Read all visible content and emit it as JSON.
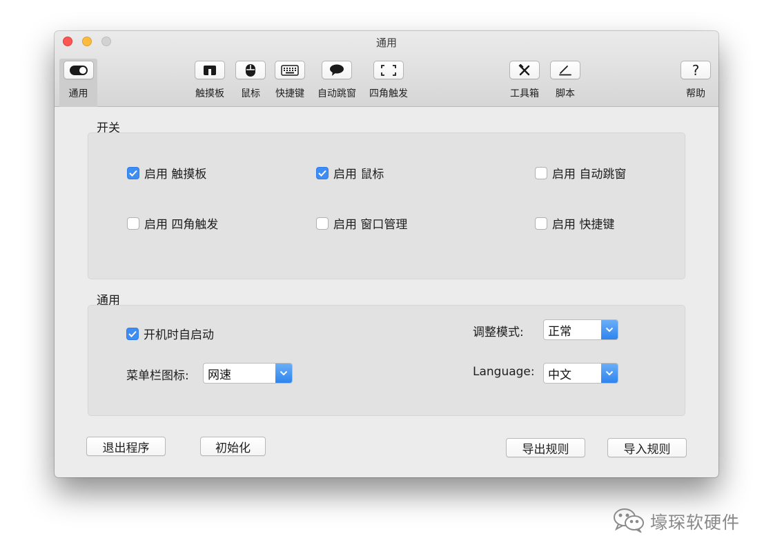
{
  "window": {
    "title": "通用"
  },
  "toolbar": {
    "items": [
      {
        "label": "通用",
        "icon": "toggle-icon"
      },
      {
        "label": "触摸板",
        "icon": "trackpad-icon"
      },
      {
        "label": "鼠标",
        "icon": "mouse-icon"
      },
      {
        "label": "快捷键",
        "icon": "keyboard-icon"
      },
      {
        "label": "自动跳窗",
        "icon": "speech-bubble-icon"
      },
      {
        "label": "四角触发",
        "icon": "corners-icon"
      },
      {
        "label": "工具箱",
        "icon": "tools-icon"
      },
      {
        "label": "脚本",
        "icon": "pen-icon"
      },
      {
        "label": "帮助",
        "icon": "help-icon",
        "glyph": "?"
      }
    ]
  },
  "switches": {
    "title": "开关",
    "items": [
      {
        "label": "启用 触摸板",
        "checked": true
      },
      {
        "label": "启用 鼠标",
        "checked": true
      },
      {
        "label": "启用 自动跳窗",
        "checked": false
      },
      {
        "label": "启用 四角触发",
        "checked": false
      },
      {
        "label": "启用 窗口管理",
        "checked": false
      },
      {
        "label": "启用 快捷键",
        "checked": false
      }
    ]
  },
  "general": {
    "title": "通用",
    "autostart": {
      "label": "开机时自启动",
      "checked": true
    },
    "menubar_icon": {
      "label": "菜单栏图标:",
      "value": "网速"
    },
    "adjust_mode": {
      "label": "调整模式:",
      "value": "正常"
    },
    "language": {
      "label": "Language:",
      "value": "中文"
    }
  },
  "buttons": {
    "quit": "退出程序",
    "reset": "初始化",
    "export": "导出规则",
    "import": "导入规则"
  },
  "colors": {
    "accent": "#3d8df5",
    "close": "#fc5753",
    "minimize": "#fdbc40",
    "maximize": "#d2d2d2"
  },
  "watermark": {
    "text": "壕琛软硬件",
    "icon": "wechat-icon"
  }
}
